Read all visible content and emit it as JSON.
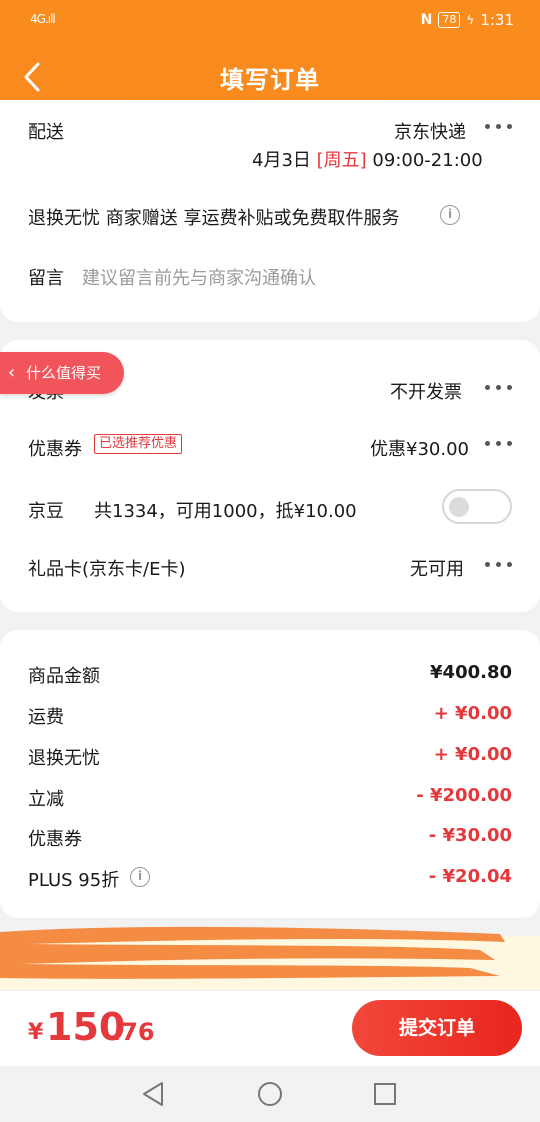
{
  "status_bar": {
    "signal": "4G.ıll",
    "battery": "78",
    "time": "1:31"
  },
  "nav": {
    "title": "填写订单"
  },
  "delivery": {
    "label": "配送",
    "carrier": "京东快递",
    "date": "4月3日",
    "weekday": "[周五]",
    "time_range": "09:00-21:00",
    "return_service": "退换无忧 商家赠送 享运费补贴或免费取件服务",
    "message_label": "留言",
    "message_placeholder": "建议留言前先与商家沟通确认"
  },
  "floating_tag": {
    "label": "什么值得买"
  },
  "invoice": {
    "label": "发票",
    "value": "不开发票"
  },
  "coupon": {
    "label": "优惠券",
    "badge": "已选推荐优惠",
    "value": "优惠¥30.00"
  },
  "jingdou": {
    "label": "京豆",
    "desc": "共1334，可用1000，抵¥10.00",
    "enabled": false
  },
  "giftcard": {
    "label": "礼品卡(京东卡/E卡)",
    "value": "无可用"
  },
  "summary": [
    {
      "label": "商品金额",
      "amount": "¥400.80",
      "color": "#1a1a1a"
    },
    {
      "label": "运费",
      "amount": "+ ¥0.00",
      "color": "#e4393c"
    },
    {
      "label": "退换无忧",
      "amount": "+ ¥0.00",
      "color": "#e4393c"
    },
    {
      "label": "立减",
      "amount": "- ¥200.00",
      "color": "#e4393c"
    },
    {
      "label": "优惠券",
      "amount": "- ¥30.00",
      "color": "#e4393c"
    },
    {
      "label": "PLUS 95折",
      "amount": "- ¥20.04",
      "color": "#e4393c"
    }
  ],
  "total": {
    "currency": "¥",
    "integer": "150",
    "decimal": ".76"
  },
  "submit_label": "提交订单",
  "colors": {
    "accent": "#f98c1c",
    "price_red": "#e4393c",
    "submit_red": "#e8261e"
  }
}
